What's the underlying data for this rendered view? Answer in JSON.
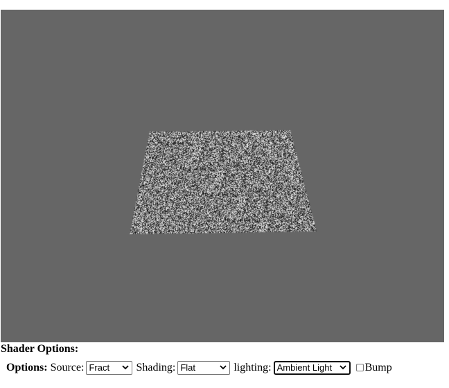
{
  "shader_options": {
    "title": "Shader Options:"
  },
  "options": {
    "label": "Options:",
    "source": {
      "label": "Source:",
      "selected": "Fract"
    },
    "shading": {
      "label": "Shading:",
      "selected": "Flat"
    },
    "lighting": {
      "label": "lighting:",
      "selected": "Ambient Light"
    },
    "bump": {
      "label": "Bump",
      "checked": false
    }
  },
  "colors": {
    "viewport_background": "#666666"
  },
  "icons": {
    "dropdown": "chevron-down-icon"
  }
}
